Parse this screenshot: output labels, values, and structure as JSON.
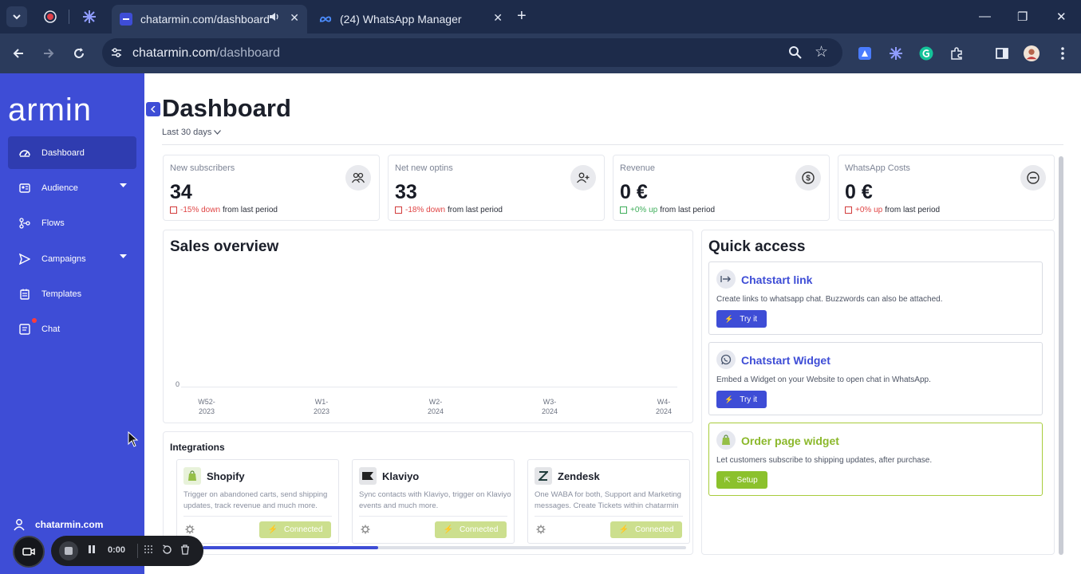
{
  "browser": {
    "tabs": [
      {
        "title": "chatarmin.com/dashboard",
        "active": true
      },
      {
        "title": "(24) WhatsApp Manager",
        "active": false
      }
    ],
    "new_tab": "+",
    "window_controls": {
      "minimize": "—",
      "restore": "❐",
      "close": "✕"
    },
    "url_host": "chatarmin.com",
    "url_path": "/dashboard"
  },
  "sidebar": {
    "brand": "armin",
    "items": [
      {
        "label": "Dashboard",
        "icon": "gauge-icon",
        "active": true
      },
      {
        "label": "Audience",
        "icon": "audience-icon",
        "expandable": true
      },
      {
        "label": "Flows",
        "icon": "flows-icon"
      },
      {
        "label": "Campaigns",
        "icon": "send-icon",
        "expandable": true
      },
      {
        "label": "Templates",
        "icon": "templates-icon"
      },
      {
        "label": "Chat",
        "icon": "chat-icon",
        "badge": true
      }
    ],
    "account": "chatarmin.com"
  },
  "header": {
    "title": "Dashboard",
    "date_range": "Last 30 days"
  },
  "stats": [
    {
      "label": "New subscribers",
      "value": "34",
      "change": "-15% down",
      "direction": "down",
      "suffix": "from last period",
      "icon": "users-icon"
    },
    {
      "label": "Net new optins",
      "value": "33",
      "change": "-18% down",
      "direction": "down",
      "suffix": "from last period",
      "icon": "user-plus-icon"
    },
    {
      "label": "Revenue",
      "value": "0 €",
      "change": "+0% up",
      "direction": "up",
      "suffix": "from last period",
      "icon": "dollar-icon"
    },
    {
      "label": "WhatsApp Costs",
      "value": "0 €",
      "change": "+0% up",
      "direction": "up",
      "suffix": "from last period",
      "icon": "minus-circle-icon"
    }
  ],
  "sales_overview": {
    "title": "Sales overview",
    "chart_data": {
      "type": "line",
      "title": "Sales overview",
      "categories": [
        "W52-2023",
        "W1-2023",
        "W2-2024",
        "W3-2024",
        "W4-2024"
      ],
      "series": [
        {
          "values": [
            0,
            0,
            0,
            0,
            0
          ]
        }
      ],
      "ytick_labels": [
        "0"
      ],
      "grid": false
    },
    "ticks": [
      {
        "line1": "W52-",
        "line2": "2023"
      },
      {
        "line1": "W1-",
        "line2": "2023"
      },
      {
        "line1": "W2-",
        "line2": "2024"
      },
      {
        "line1": "W3-",
        "line2": "2024"
      },
      {
        "line1": "W4-",
        "line2": "2024"
      }
    ],
    "y_zero": "0"
  },
  "quick_access": {
    "title": "Quick access",
    "items": [
      {
        "title": "Chatstart link",
        "desc": "Create links to whatsapp chat. Buzzwords can also be attached.",
        "button": "Try it"
      },
      {
        "title": "Chatstart Widget",
        "desc": "Embed a Widget on your Website to open chat in WhatsApp.",
        "button": "Try it"
      },
      {
        "title": "Order page widget",
        "desc": "Let customers subscribe to shipping updates, after purchase.",
        "button": "Setup"
      }
    ]
  },
  "integrations": {
    "title": "Integrations",
    "items": [
      {
        "name": "Shopify",
        "desc": "Trigger on abandoned carts, send shipping updates, track revenue and much more.",
        "status": "Connected"
      },
      {
        "name": "Klaviyo",
        "desc": "Sync contacts with Klaviyo, trigger on Klaviyo events and much more.",
        "status": "Connected"
      },
      {
        "name": "Zendesk",
        "desc": "One WABA for both, Support and Marketing messages. Create Tickets within chatarmin",
        "status": "Connected"
      }
    ]
  },
  "recorder": {
    "time": "0:00"
  }
}
